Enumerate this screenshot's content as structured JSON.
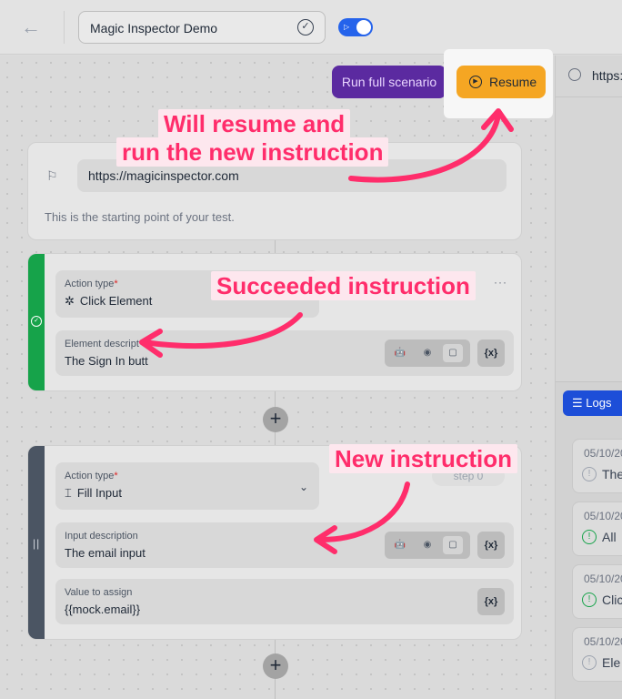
{
  "topbar": {
    "back_icon": "arrow-left-icon",
    "scenario_name": "Magic Inspector Demo"
  },
  "actions": {
    "run_full_label": "Run full scenario",
    "resume_label": "Resume"
  },
  "browser": {
    "url_partial": "https:"
  },
  "start": {
    "url": "https://magicinspector.com",
    "description": "This is the starting point of your test."
  },
  "steps": [
    {
      "status": "succeeded",
      "action_label": "Action type",
      "action_value": "Click Element",
      "action_glyph": "✲",
      "desc_label": "Element descript",
      "desc_value": "The Sign In butt",
      "var_label": "{x}"
    },
    {
      "status": "new",
      "badge": "step 0",
      "action_label": "Action type",
      "action_value": "Fill Input",
      "action_glyph": "⌶",
      "desc_label": "Input description",
      "desc_value": "The email input",
      "value_label": "Value to assign",
      "value_value": "{{mock.email}}",
      "var_label": "{x}"
    }
  ],
  "logs": {
    "tab_label": "Logs",
    "entries": [
      {
        "date": "05/10/20",
        "msg": "The",
        "status": "neutral"
      },
      {
        "date": "05/10/20",
        "msg": "All",
        "status": "success"
      },
      {
        "date": "05/10/20",
        "msg": "Clic",
        "status": "success"
      },
      {
        "date": "05/10/20",
        "msg": "Ele",
        "status": "neutral"
      }
    ]
  },
  "annotations": {
    "resume_line1": "Will resume and",
    "resume_line2": "run the new instruction",
    "succeeded": "Succeeded instruction",
    "new": "New instruction"
  },
  "colors": {
    "annotation": "#ff2d6b",
    "success_bar": "#16a34a",
    "resume": "#f5a623",
    "run_full": "#5b2aa0",
    "logs_tab": "#1d4ed8"
  }
}
